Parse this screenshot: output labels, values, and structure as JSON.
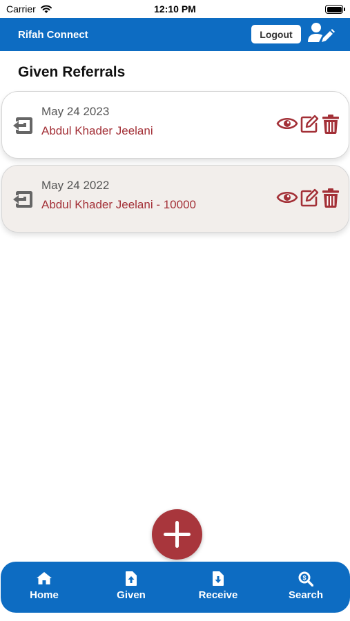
{
  "status_bar": {
    "carrier": "Carrier",
    "time": "12:10 PM"
  },
  "header": {
    "title": "Rifah Connect",
    "logout_label": "Logout",
    "profile_icon": "user-edit-icon"
  },
  "page_title": "Given Referrals",
  "referrals": [
    {
      "date": "May 24 2023",
      "name": "Abdul Khader Jeelani"
    },
    {
      "date": "May 24 2022",
      "name": "Abdul Khader Jeelani - 10000"
    }
  ],
  "fab": {
    "icon": "plus-icon"
  },
  "bottom_nav": [
    {
      "label": "Home",
      "icon": "home-icon"
    },
    {
      "label": "Given",
      "icon": "file-upload-icon"
    },
    {
      "label": "Receive",
      "icon": "file-download-icon"
    },
    {
      "label": "Search",
      "icon": "search-dollar-icon"
    }
  ],
  "colors": {
    "primary": "#0d6cc2",
    "accent": "#a33037",
    "card_alt": "#f2eeeb"
  }
}
